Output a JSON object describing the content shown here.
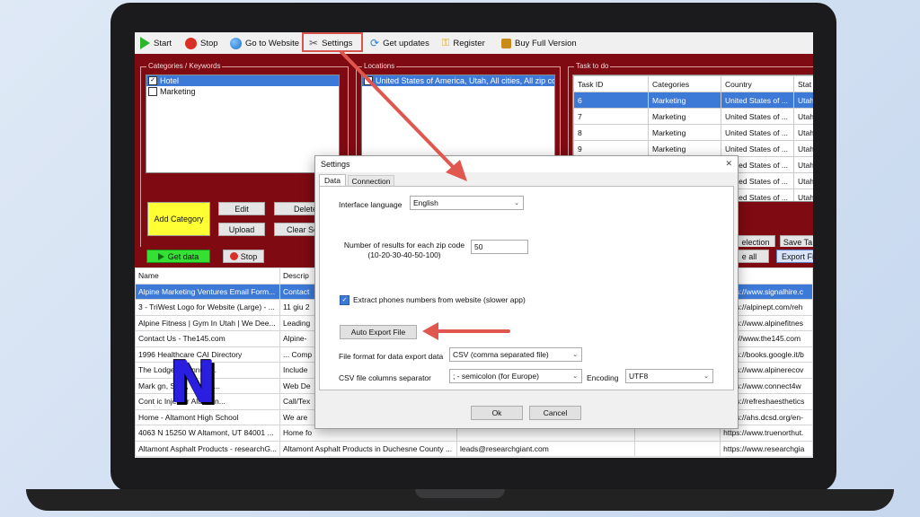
{
  "toolbar": {
    "items": [
      {
        "label": "Start",
        "icon": "play-icon",
        "color": "#2db52d"
      },
      {
        "label": "Stop",
        "icon": "stop-icon",
        "color": "#d93025"
      },
      {
        "label": "Go to Website",
        "icon": "globe-icon",
        "color": "#2a7fd4"
      },
      {
        "label": "Settings",
        "icon": "tools-icon",
        "color": "#555555"
      },
      {
        "label": "Get updates",
        "icon": "refresh-icon",
        "color": "#2a7fd4"
      },
      {
        "label": "Register",
        "icon": "key-icon",
        "color": "#e0a800"
      },
      {
        "label": "Buy Full Version",
        "icon": "shopping-bag-icon",
        "color": "#c98a1a"
      }
    ]
  },
  "categories": {
    "title": "Categories / Keywords",
    "items": [
      {
        "label": "Hotel",
        "checked": true
      },
      {
        "label": "Marketing",
        "checked": false
      }
    ],
    "add_label": "Add Category",
    "edit_label": "Edit",
    "delete_label": "Delete",
    "upload_label": "Upload",
    "clear_label": "Clear Sele"
  },
  "locations": {
    "title": "Locations",
    "items": [
      "United States of America, Utah, All cities, All zip code"
    ]
  },
  "tasks": {
    "title": "Task to do",
    "columns": [
      "Task ID",
      "Categories",
      "Country",
      "Stat"
    ],
    "rows": [
      [
        "6",
        "Marketing",
        "United States of ...",
        "Utah"
      ],
      [
        "7",
        "Marketing",
        "United States of ...",
        "Utah"
      ],
      [
        "8",
        "Marketing",
        "United States of ...",
        "Utah"
      ],
      [
        "9",
        "Marketing",
        "United States of ...",
        "Utah"
      ],
      [
        "",
        "",
        "United States of ...",
        "Utah"
      ],
      [
        "",
        "",
        "United States of ...",
        "Utah"
      ],
      [
        "",
        "",
        "United States of ...",
        "Utah"
      ]
    ],
    "selection_label": "election",
    "save_label": "Save Ta"
  },
  "lower_bar": {
    "get_data_label": "Get data",
    "stop_label": "Stop",
    "select_all_label": "e all",
    "export_label": "Export Fi"
  },
  "results": {
    "columns": [
      "Name",
      "Descrip",
      "",
      "",
      "RL"
    ],
    "rows": [
      [
        "Alpine Marketing Ventures Email Form...",
        "Contact",
        "",
        "",
        "https://www.signalhire.c"
      ],
      [
        "3 - TriWest Logo for Website (Large) - ...",
        "11 giu 2",
        "",
        "",
        "https://alpinept.com/reh"
      ],
      [
        "Alpine Fitness | Gym In Utah | We Dee...",
        "Leading",
        "",
        "",
        "https://www.alpinefitnes"
      ],
      [
        "Contact Us - The145.com",
        "Alpine-",
        "",
        "",
        "http://www.the145.com"
      ],
      [
        "1996 Healthcare CAI Directory",
        "... Comp",
        "",
        "",
        "https://books.google.it/b"
      ],
      [
        "The          Lodge Bi-Annual...",
        "Include",
        "",
        "",
        "https://www.alpinerecov"
      ],
      [
        "Mark          gn, SEO, Web D...",
        "Web De",
        "",
        "",
        "https://www.connect4w"
      ],
      [
        "Cont          ic Injector Altamon...",
        "Call/Tex",
        "",
        "",
        "https://refreshaesthetics"
      ],
      [
        "Home - Altamont High School",
        "We are",
        "",
        "",
        "https://ahs.dcsd.org/en-"
      ],
      [
        "4063 N 15250 W Altamont, UT 84001 ...",
        "Home fo",
        "",
        "",
        "https://www.truenorthut."
      ],
      [
        "Altamont Asphalt Products - researchG...",
        "Altamont Asphalt Products in Duchesne County ...",
        "leads@researchgiant.com",
        "",
        "https://www.researchgia"
      ]
    ]
  },
  "dialog": {
    "title": "Settings",
    "tabs": [
      "Data",
      "Connection"
    ],
    "interface_language_label": "Interface language",
    "interface_language_value": "English",
    "results_label_line1": "Number of results for each zip code",
    "results_label_line2": "(10-20-30-40-50-100)",
    "results_value": "50",
    "extract_phones_label": "Extract phones numbers from website (slower app)",
    "extract_phones_checked": true,
    "auto_export_label": "Auto Export File",
    "file_format_label": "File format for data export data",
    "file_format_value": "CSV (comma separated file)",
    "csv_separator_label": "CSV file columns separator",
    "csv_separator_value": "; - semicolon (for Europe)",
    "encoding_label": "Encoding",
    "encoding_value": "UTF8",
    "ok_label": "Ok",
    "cancel_label": "Cancel",
    "close_glyph": "✕"
  },
  "logo": {
    "text": "N"
  },
  "colors": {
    "panel_red": "#7f0a12",
    "selection_blue": "#3d7ad8",
    "annotation_red": "#e0574f"
  }
}
